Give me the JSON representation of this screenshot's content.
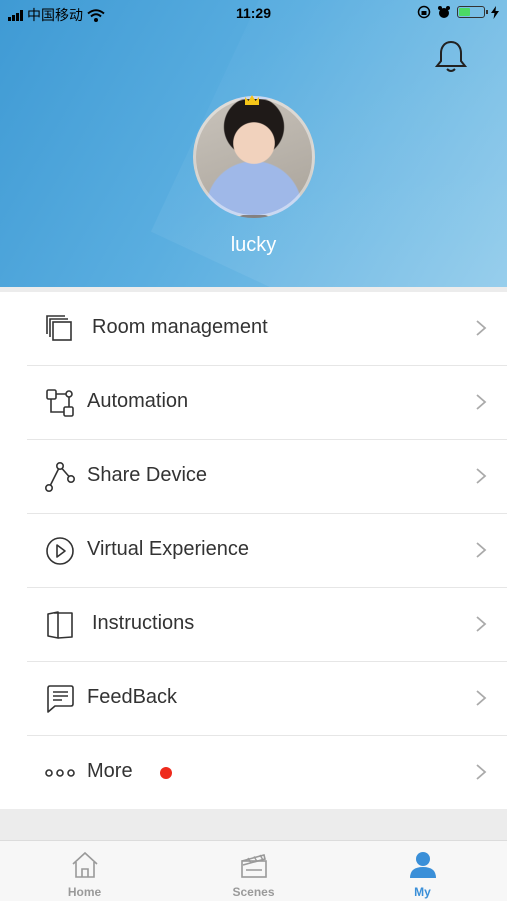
{
  "status_bar": {
    "carrier": "中国移动",
    "time": "11:29"
  },
  "profile": {
    "username": "lucky",
    "bell_icon": "bell-icon"
  },
  "menu": {
    "items": [
      {
        "label": "Room management",
        "icon": "room-icon"
      },
      {
        "label": "Automation",
        "icon": "automation-icon"
      },
      {
        "label": "Share Device",
        "icon": "share-icon"
      },
      {
        "label": "Virtual Experience",
        "icon": "play-icon"
      },
      {
        "label": "Instructions",
        "icon": "book-icon"
      },
      {
        "label": "FeedBack",
        "icon": "message-icon"
      },
      {
        "label": "More",
        "icon": "more-icon",
        "badge_color": "#ee2a1c"
      }
    ]
  },
  "tabbar": {
    "tabs": [
      {
        "label": "Home",
        "icon": "home-icon"
      },
      {
        "label": "Scenes",
        "icon": "scenes-icon"
      },
      {
        "label": "My",
        "icon": "user-icon",
        "active": true
      }
    ],
    "active_color": "#3a8fd8"
  }
}
